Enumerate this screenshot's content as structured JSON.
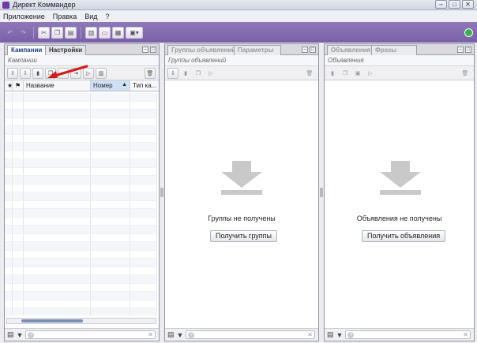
{
  "window": {
    "title": "Директ Коммандер",
    "controls": [
      "–",
      "□",
      "✕"
    ]
  },
  "menu": [
    "Приложение",
    "Правка",
    "Вид",
    "?"
  ],
  "panels": {
    "campaigns": {
      "tabs": [
        "Кампании",
        "Настройки"
      ],
      "breadcrumb": "Кампании",
      "columns": [
        "★",
        "⚑",
        "Название",
        "Номер",
        "Тип ка..."
      ],
      "sort_indicator": "▲",
      "filter_placeholder": ""
    },
    "groups": {
      "tabs": [
        "Группы объявлений",
        "Параметры"
      ],
      "breadcrumb": "Группы объявлений",
      "empty_message": "Группы не получены",
      "button": "Получить группы"
    },
    "ads": {
      "tabs": [
        "Объявления",
        "Фразы"
      ],
      "breadcrumb": "Объявления",
      "empty_message": "Объявления не получены",
      "button": "Получить объявления"
    }
  },
  "accent": {
    "toolbar": "#7f65ae",
    "refresh": "#37b34a",
    "annotation": "#d21c1c"
  }
}
